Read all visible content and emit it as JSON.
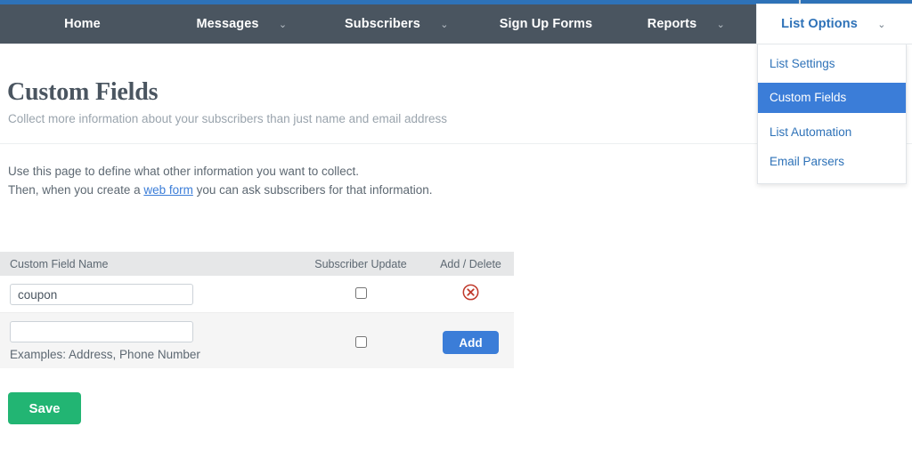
{
  "nav": {
    "items": [
      {
        "label": "Home",
        "caret": false,
        "open": false
      },
      {
        "label": "Messages",
        "caret": true,
        "open": false
      },
      {
        "label": "Subscribers",
        "caret": true,
        "open": false
      },
      {
        "label": "Sign Up Forms",
        "caret": false,
        "open": false
      },
      {
        "label": "Reports",
        "caret": true,
        "open": false
      },
      {
        "label": "List Options",
        "caret": true,
        "open": true
      }
    ],
    "caret_glyph": "⌄"
  },
  "dropdown": {
    "items": [
      {
        "label": "List Settings",
        "selected": false
      },
      {
        "label": "Custom Fields",
        "selected": true
      },
      {
        "label": "List Automation",
        "selected": false
      },
      {
        "label": "Email Parsers",
        "selected": false
      }
    ]
  },
  "page": {
    "title": "Custom Fields",
    "subtitle": "Collect more information about your subscribers than just name and email address",
    "intro_line1": "Use this page to define what other information you want to collect.",
    "intro_line2_before": "Then, when you create a ",
    "intro_link": "web form",
    "intro_line2_after": " you can ask subscribers for that information."
  },
  "table": {
    "headers": {
      "name": "Custom Field Name",
      "update": "Subscriber Update",
      "adddel": "Add / Delete"
    },
    "rows": [
      {
        "value": "coupon",
        "placeholder": "",
        "checked": false,
        "action": "delete",
        "action_label": "Delete custom field",
        "hint": ""
      },
      {
        "value": "",
        "placeholder": "",
        "checked": false,
        "action": "add",
        "action_label": "Add",
        "hint": "Examples: Address, Phone Number"
      }
    ]
  },
  "footer": {
    "save_label": "Save"
  },
  "colors": {
    "nav_bg": "#4a5560",
    "strip_blue": "#2e72b8",
    "accent_blue": "#3b7dd8",
    "save_green": "#22b573",
    "delete_red": "#c0392b",
    "header_gray": "#e6e7e8"
  }
}
